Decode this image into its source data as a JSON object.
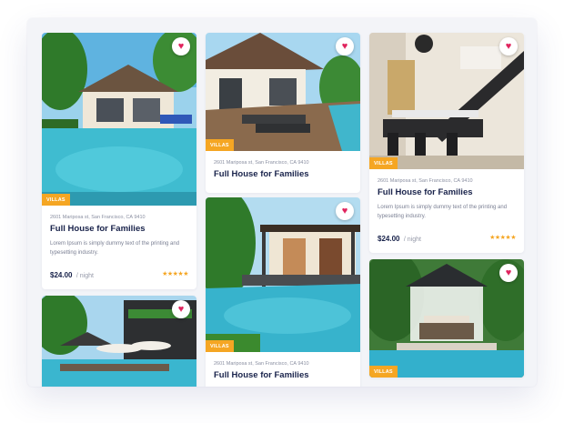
{
  "icons": {
    "favorite": "heart-icon",
    "rating": "star-icon"
  },
  "colors": {
    "accent": "#f5a623",
    "heart": "#e0245e",
    "title": "#18224a"
  },
  "listings": [
    {
      "address": "2601 Mariposa st, San Francisco, CA 9410",
      "title": "Full House for Families",
      "description": "Lorem Ipsum is simply dummy text of the printing and typesetting industry.",
      "price": "$24.00",
      "unit": "/ night",
      "tag": "VILLAS",
      "stars": "★★★★★",
      "heart": "♥"
    },
    {
      "address": "2601 Mariposa st, San Francisco, CA 9410",
      "title": "Full House for Families",
      "tag": "VILLAS",
      "heart": "♥"
    },
    {
      "address": "2601 Mariposa st, San Francisco, CA 9410",
      "title": "Full House for Families",
      "description": "Lorem Ipsum is simply dummy text of the printing and typesetting industry.",
      "price": "$24.00",
      "unit": "/ night",
      "tag": "VILLAS",
      "stars": "★★★★★",
      "heart": "♥"
    },
    {
      "heart": "♥"
    },
    {
      "address": "2601 Mariposa st, San Francisco, CA 9410",
      "title": "Full House for Families",
      "tag": "VILLAS",
      "heart": "♥"
    },
    {
      "tag": "VILLAS",
      "heart": "♥"
    }
  ]
}
